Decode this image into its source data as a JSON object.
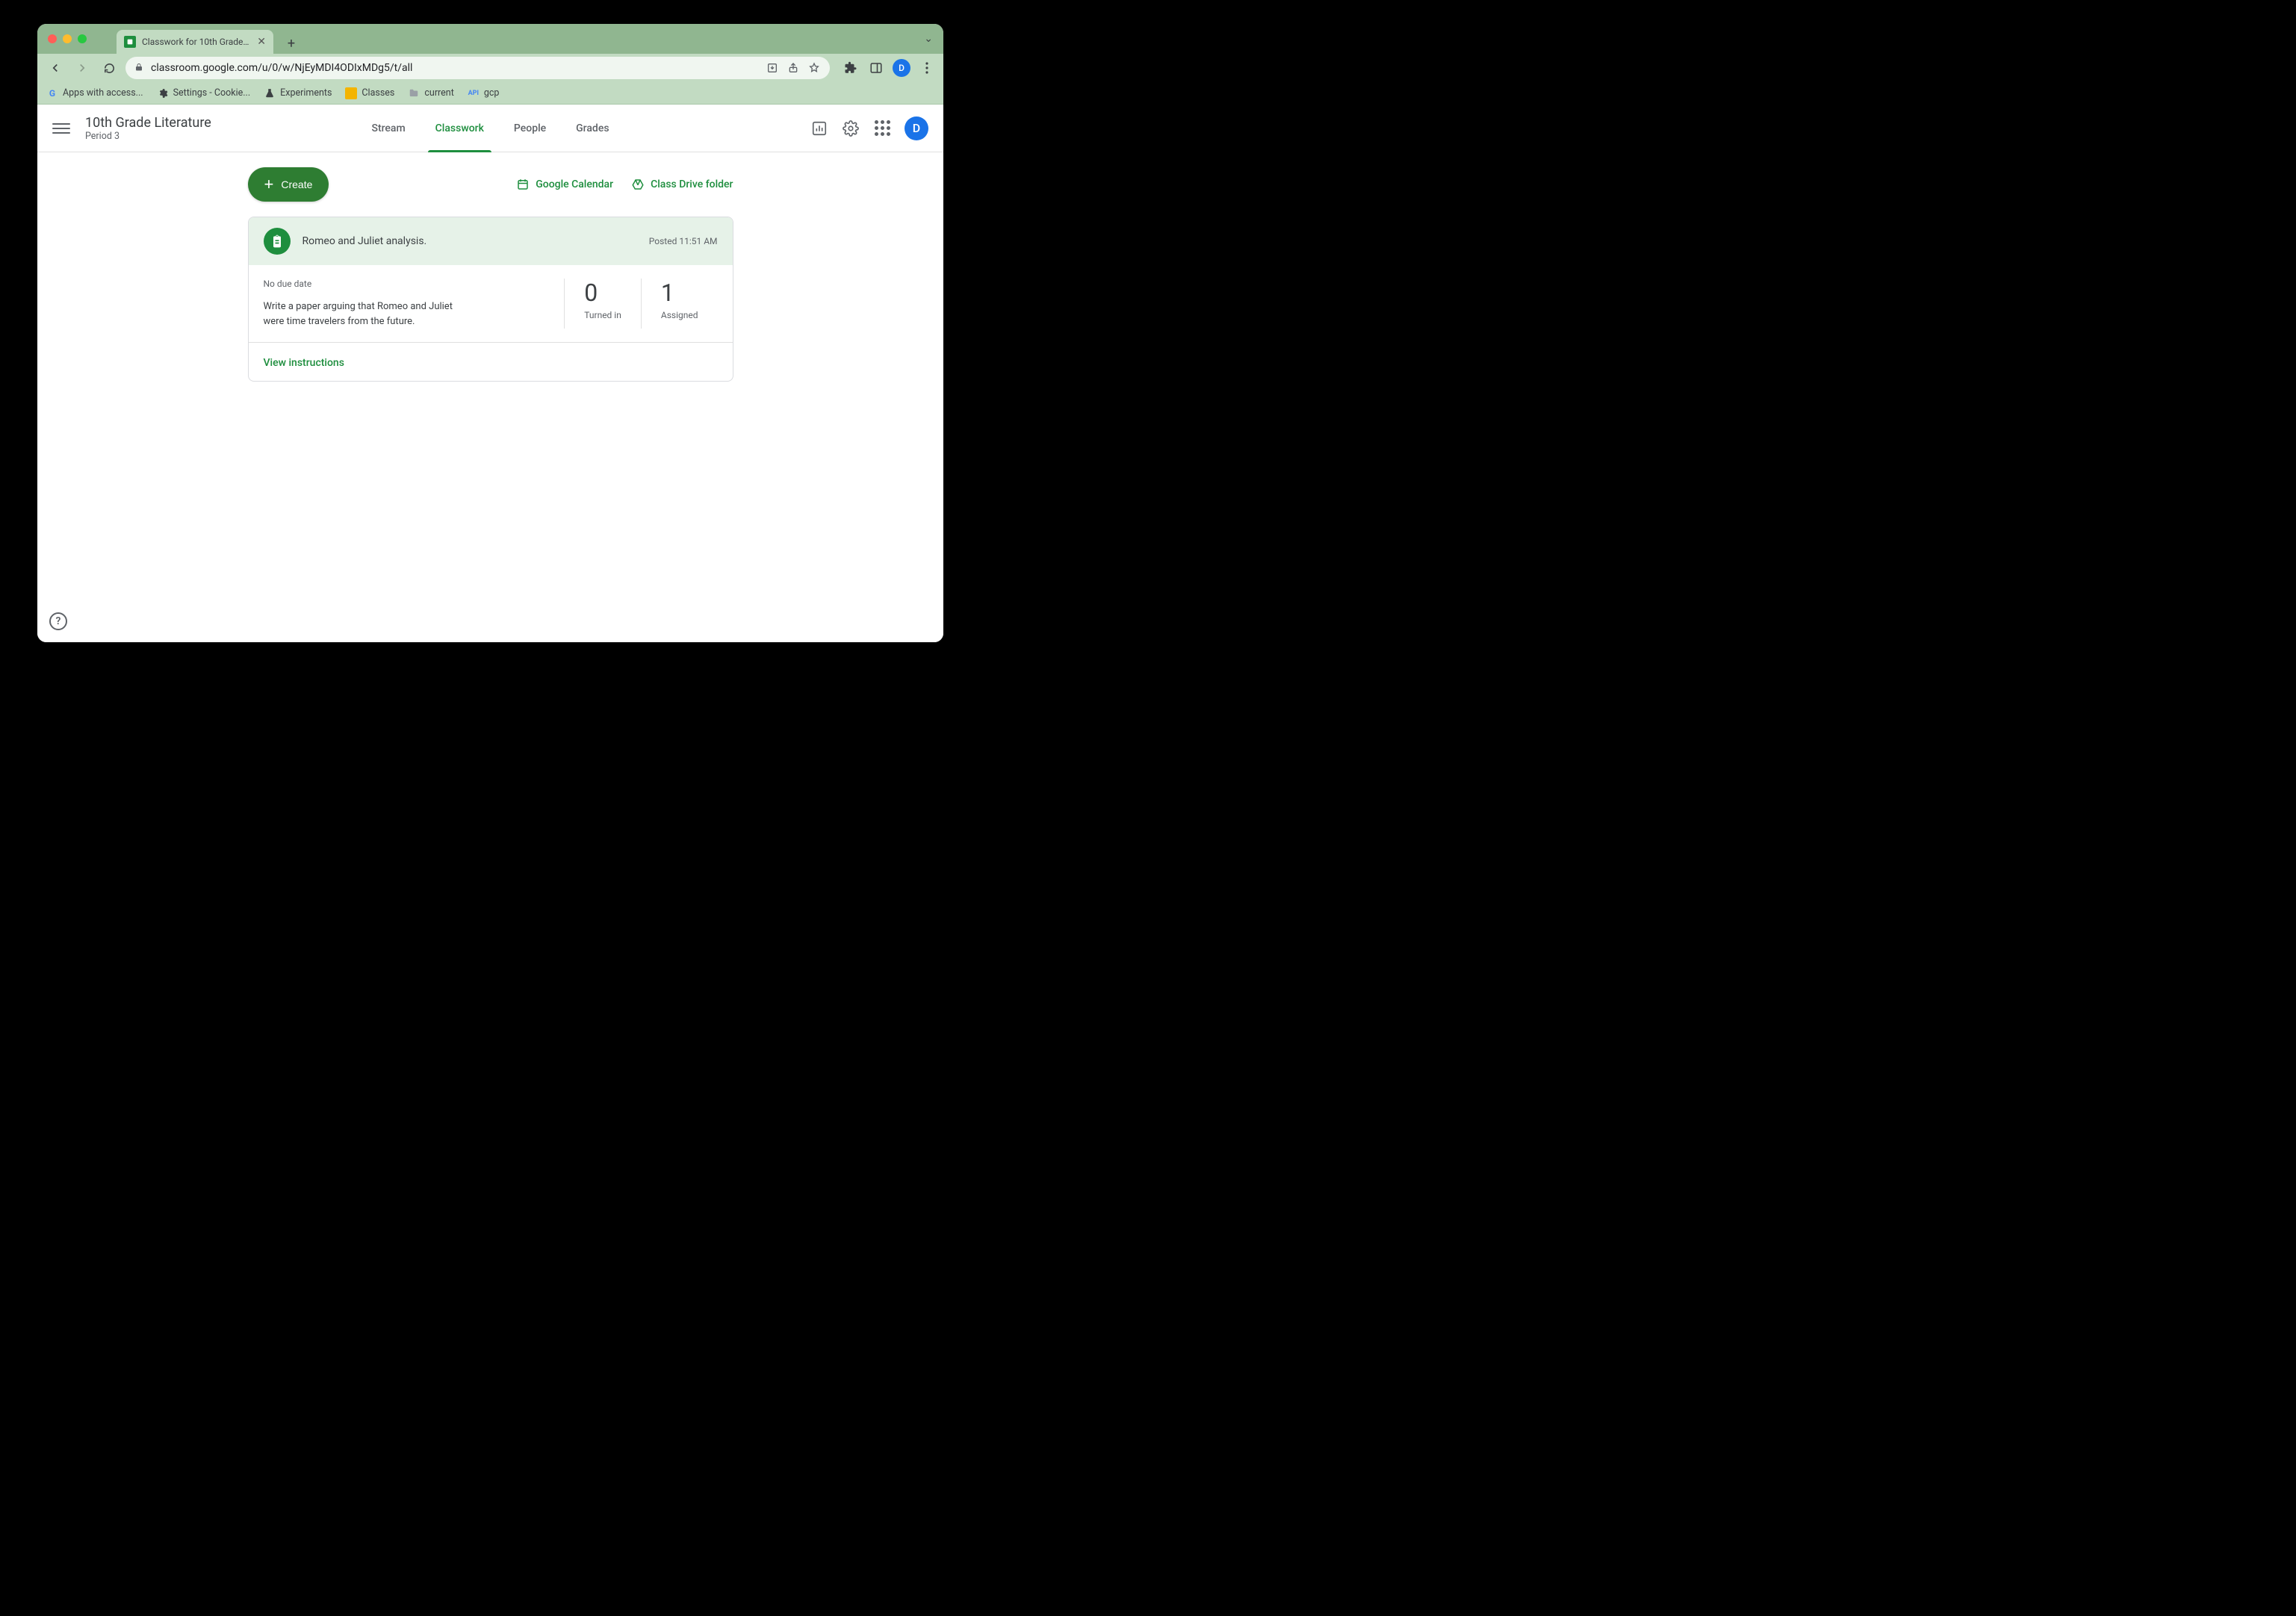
{
  "browser": {
    "tab_title": "Classwork for 10th Grade Litera",
    "url": "classroom.google.com/u/0/w/NjEyMDI4ODIxMDg5/t/all",
    "bookmarks": [
      {
        "label": "Apps with access...",
        "icon": "G"
      },
      {
        "label": "Settings - Cookie...",
        "icon": "gear"
      },
      {
        "label": "Experiments",
        "icon": "flask"
      },
      {
        "label": "Classes",
        "icon": "classroom"
      },
      {
        "label": "current",
        "icon": "folder"
      },
      {
        "label": "gcp",
        "icon": "api"
      }
    ],
    "avatar_letter": "D"
  },
  "header": {
    "class_title": "10th Grade Literature",
    "class_sub": "Period 3",
    "tabs": [
      "Stream",
      "Classwork",
      "People",
      "Grades"
    ],
    "active_tab": "Classwork",
    "avatar_letter": "D"
  },
  "actions": {
    "create_label": "Create",
    "calendar_label": "Google Calendar",
    "drive_label": "Class Drive folder"
  },
  "assignment": {
    "title": "Romeo and Juliet analysis.",
    "posted": "Posted 11:51 AM",
    "due": "No due date",
    "description": "Write a paper arguing that Romeo and Juliet were time travelers from the future.",
    "turned_in_count": "0",
    "turned_in_label": "Turned in",
    "assigned_count": "1",
    "assigned_label": "Assigned",
    "view_label": "View instructions"
  }
}
